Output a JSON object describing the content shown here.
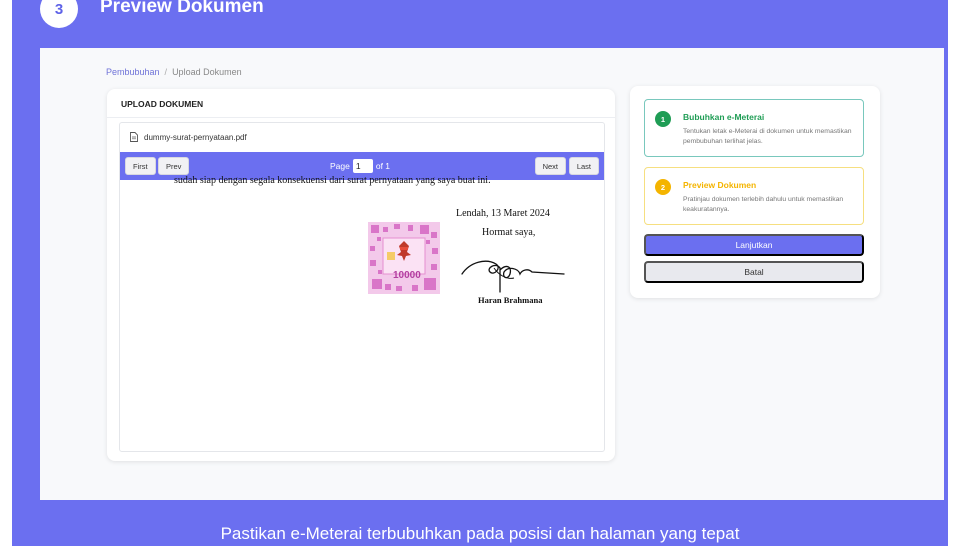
{
  "header": {
    "step_number": "3",
    "title": "Preview Dokumen"
  },
  "breadcrumb": {
    "parent": "Pembubuhan",
    "separator": "/",
    "current": "Upload Dokumen"
  },
  "upload_panel": {
    "title": "UPLOAD DOKUMEN",
    "file_name": "dummy-surat-pernyataan.pdf",
    "pager": {
      "first_label": "First",
      "prev_label": "Prev",
      "page_label": "Page",
      "current_page": "1",
      "of_label": "of 1",
      "next_label": "Next",
      "last_label": "Last"
    },
    "document": {
      "line": "sudah siap dengan segala konsekuensi dari surat pernyataan yang saya buat ini.",
      "date": "Lendah, 13 Maret 2024",
      "closing": "Hormat saya,",
      "signer": "Haran Brahmana",
      "stamp_value": "10000"
    }
  },
  "steps": [
    {
      "number": "1",
      "title": "Bubuhkan e-Meterai",
      "description": "Tentukan letak e-Meterai di dokumen untuk memastikan pembubuhan terlihat jelas.",
      "color": "#1f9d55"
    },
    {
      "number": "2",
      "title": "Preview Dokumen",
      "description": "Pratinjau dokumen terlebih dahulu untuk memastikan keakuratannya.",
      "color": "#f4b400"
    }
  ],
  "actions": {
    "primary_label": "Lanjutkan",
    "secondary_label": "Batal"
  },
  "footer": {
    "caption": "Pastikan e-Meterai terbubuhkan pada posisi dan halaman yang tepat"
  },
  "colors": {
    "brand": "#6b6ff0",
    "step1": "#1f9d55",
    "step2": "#f4b400"
  }
}
